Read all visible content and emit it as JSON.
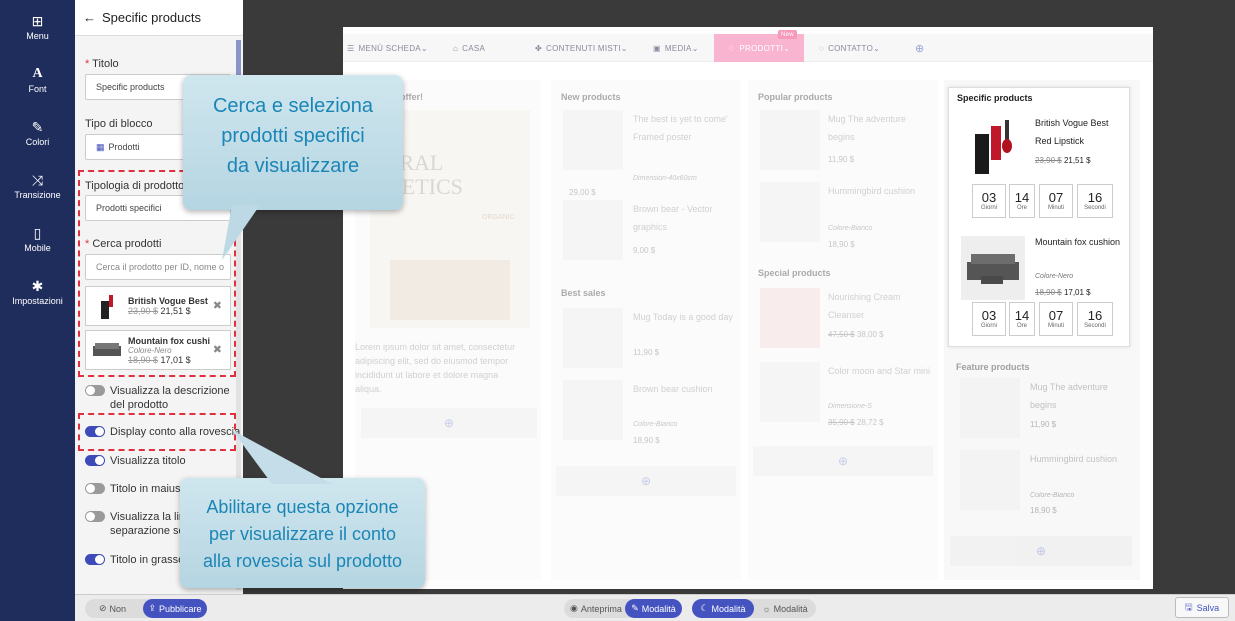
{
  "rail": [
    {
      "label": "Menu",
      "icon": "grid-icon"
    },
    {
      "label": "Font",
      "icon": "font-icon"
    },
    {
      "label": "Colori",
      "icon": "brush-icon"
    },
    {
      "label": "Transizione",
      "icon": "shuffle-icon"
    },
    {
      "label": "Mobile",
      "icon": "mobile-icon"
    },
    {
      "label": "Impostazioni",
      "icon": "gear-icon"
    }
  ],
  "panel": {
    "title": "Specific products",
    "titolo_label": "Titolo",
    "titolo_value": "Specific products",
    "tipo_label": "Tipo di blocco",
    "tipo_value": "Prodotti",
    "tipologia_label": "Tipologia di prodotto",
    "tipologia_value": "Prodotti specifici",
    "cerca_label": "Cerca prodotti",
    "cerca_placeholder": "Cerca il prodotto per ID, nome o",
    "selected": [
      {
        "name": "British Vogue Best R...",
        "old": "23,90 $",
        "new": "21,51 $",
        "variant": ""
      },
      {
        "name": "Mountain fox cushion",
        "old": "18,90 $",
        "new": "17,01 $",
        "variant": "Colore-Nero"
      }
    ],
    "toggles": [
      {
        "label1": "Visualizza la descrizione",
        "label2": "del prodotto",
        "on": false
      },
      {
        "label1": "Display conto alla rovescia",
        "label2": "",
        "on": true
      },
      {
        "label1": "Visualizza titolo",
        "label2": "",
        "on": true
      },
      {
        "label1": "Titolo in maiusc",
        "label2": "",
        "on": false
      },
      {
        "label1": "Visualizza la line",
        "label2": "separazione sot",
        "on": false
      },
      {
        "label1": "Titolo in grasset",
        "label2": "",
        "on": true
      }
    ]
  },
  "bottom": {
    "non": "Non",
    "publish": "Pubblicare",
    "anteprima": "Anteprima",
    "modalita1": "Modalità",
    "modalita2": "Modalità",
    "modalita3": "Modalità",
    "save": "Salva"
  },
  "nav": [
    {
      "label": "MENÙ SCHEDA"
    },
    {
      "label": "CASA"
    },
    {
      "label": "CONTENUTI MISTI"
    },
    {
      "label": "MEDIA"
    },
    {
      "label": "PRODOTTI"
    },
    {
      "label": "CONTATTO"
    }
  ],
  "nav_new": "New",
  "col1": {
    "title": "offer!",
    "hero1": "TURAL",
    "hero2": "SMETICS",
    "badge": "ORGANIC",
    "text": "Lorem ipsum dolor sit amet, consectetur adipiscing elit, sed do eiusmod tempor incididunt ut labore et dolore magna aliqua."
  },
  "col2": {
    "new_title": "New products",
    "p1": {
      "name": "The best is yet to come' Framed poster",
      "variant": "Dimension-40x60cm",
      "price": "29,00 $"
    },
    "p2": {
      "name": "Brown bear - Vector graphics",
      "price": "9,00 $"
    },
    "best_title": "Best sales",
    "p3": {
      "name": "Mug Today is a good day",
      "price": "11,90 $"
    },
    "p4": {
      "name": "Brown bear cushion",
      "variant": "Colore-Bianco",
      "price": "18,90 $"
    }
  },
  "col3": {
    "popular_title": "Popular products",
    "p1": {
      "name": "Mug The adventure begins",
      "price": "11,90 $"
    },
    "p2": {
      "name": "Hummingbird cushion",
      "variant": "Colore-Bianco",
      "price": "18,90 $"
    },
    "special_title": "Special products",
    "p3": {
      "name": "Nourishing Cream Cleanser",
      "old": "47,50 $",
      "price": "38,00 $"
    },
    "p4": {
      "name": "Color moon and Star mini",
      "variant": "Dimensione-S",
      "old": "35,90 $",
      "price": "28,72 $"
    }
  },
  "col4": {
    "specific_title": "Specific products",
    "s1": {
      "name": "British Vogue Best Red Lipstick",
      "old": "23,90 $",
      "price": "21,51 $"
    },
    "s2": {
      "name": "Mountain fox cushion",
      "variant": "Colore-Nero",
      "old": "18,90 $",
      "price": "17,01 $"
    },
    "countdown": [
      {
        "n": "03",
        "u": "Giorni"
      },
      {
        "n": "14",
        "u": "Ore"
      },
      {
        "n": "07",
        "u": "Minuti"
      },
      {
        "n": "16",
        "u": "Secondi"
      }
    ],
    "feature_title": "Feature products",
    "f1": {
      "name": "Mug The adventure begins",
      "price": "11,90 $"
    },
    "f2": {
      "name": "Hummingbird cushion",
      "variant": "Colore-Bianco",
      "price": "18,90 $"
    }
  },
  "callouts": {
    "top1": "Cerca e seleziona",
    "top2": "prodotti specifici",
    "top3": "da visualizzare",
    "bot1": "Abilitare questa opzione",
    "bot2": "per visualizzare il conto",
    "bot3": "alla rovescia sul prodotto"
  }
}
